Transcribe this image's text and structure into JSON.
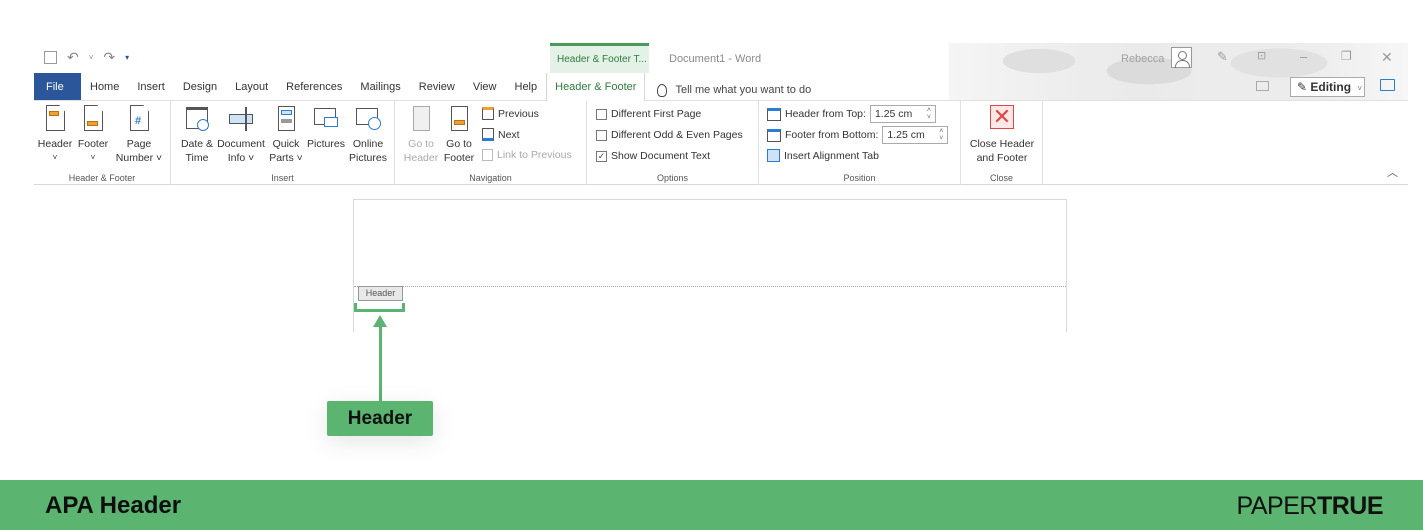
{
  "window": {
    "context_tab_group": "Header & Footer T...",
    "document_title": "Document1  -  Word",
    "user_name": "Rebecca",
    "quick_access": [
      "save-icon",
      "undo-icon",
      "redo-icon",
      "customize-icon"
    ]
  },
  "tabs": [
    {
      "label": "File"
    },
    {
      "label": "Home"
    },
    {
      "label": "Insert"
    },
    {
      "label": "Design"
    },
    {
      "label": "Layout"
    },
    {
      "label": "References"
    },
    {
      "label": "Mailings"
    },
    {
      "label": "Review"
    },
    {
      "label": "View"
    },
    {
      "label": "Help"
    },
    {
      "label": "Header & Footer",
      "active": true
    }
  ],
  "tell_me": "Tell me what you want to do",
  "editing": {
    "label": "Editing",
    "chevron": "˅"
  },
  "ribbon": {
    "header_footer_group": {
      "label": "Header & Footer",
      "header": {
        "line1": "Header",
        "line2": "˅"
      },
      "footer": {
        "line1": "Footer",
        "line2": "˅"
      },
      "page_number": {
        "line1": "Page",
        "line2": "Number ˅"
      }
    },
    "insert_group": {
      "label": "Insert",
      "date_time": {
        "line1": "Date &",
        "line2": "Time"
      },
      "document_info": {
        "line1": "Document",
        "line2": "Info ˅"
      },
      "quick_parts": {
        "line1": "Quick",
        "line2": "Parts ˅"
      },
      "pictures": {
        "line1": "Pictures",
        "line2": ""
      },
      "online_pictures": {
        "line1": "Online",
        "line2": "Pictures"
      }
    },
    "navigation_group": {
      "label": "Navigation",
      "go_to_header": {
        "line1": "Go to",
        "line2": "Header",
        "disabled": true
      },
      "go_to_footer": {
        "line1": "Go to",
        "line2": "Footer"
      },
      "previous": "Previous",
      "next": "Next",
      "link_to_previous": {
        "label": "Link to Previous",
        "disabled": true
      }
    },
    "options_group": {
      "label": "Options",
      "different_first_page": {
        "label": "Different First Page",
        "checked": false
      },
      "different_odd_even": {
        "label": "Different Odd & Even Pages",
        "checked": false
      },
      "show_document_text": {
        "label": "Show Document Text",
        "checked": true,
        "mark": "✓"
      }
    },
    "position_group": {
      "label": "Position",
      "header_from_top": {
        "label": "Header from Top:",
        "value": "1.25 cm"
      },
      "footer_from_bottom": {
        "label": "Footer from Bottom:",
        "value": "1.25 cm"
      },
      "insert_alignment_tab": "Insert Alignment Tab"
    },
    "close_group": {
      "label": "Close",
      "close_button": {
        "line1": "Close Header",
        "line2": "and Footer"
      }
    }
  },
  "document": {
    "header_tag": "Header"
  },
  "annotation": {
    "callout": "Header",
    "accent_color": "#5bb46f"
  },
  "footer_band": {
    "title": "APA Header",
    "logo_light": "PAPER",
    "logo_bold": "TRUE"
  }
}
